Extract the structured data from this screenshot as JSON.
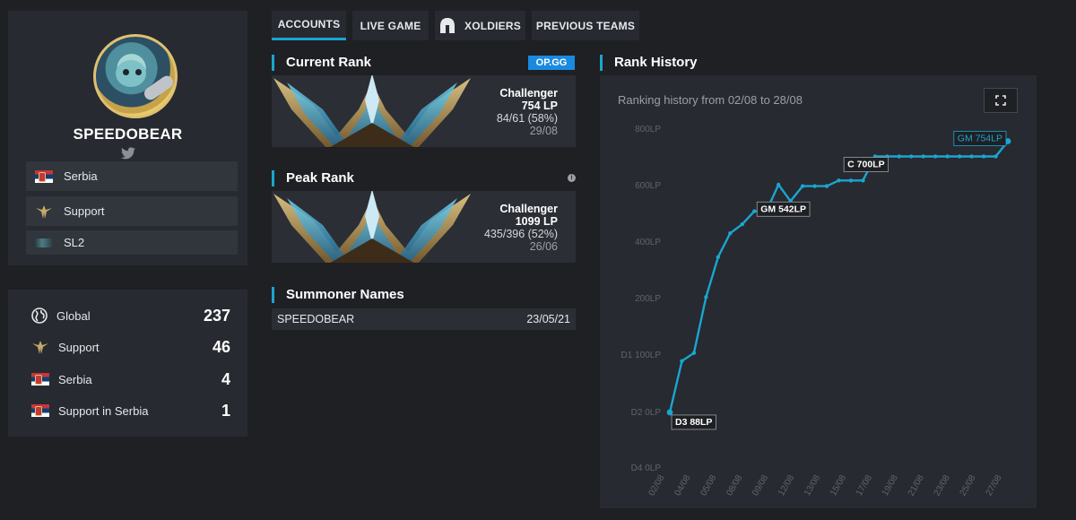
{
  "profile": {
    "name": "SPEEDOBEAR",
    "twitter_icon": "twitter-icon",
    "info": [
      {
        "icon": "serbia-flag-icon",
        "label": "Serbia"
      },
      {
        "icon": "support-role-icon",
        "label": "Support"
      },
      {
        "icon": "league-logo-icon",
        "label": "SL2"
      }
    ]
  },
  "stats": [
    {
      "icon": "globe-icon",
      "label": "Global",
      "value": "237"
    },
    {
      "icon": "support-role-icon",
      "label": "Support",
      "value": "46"
    },
    {
      "icon": "serbia-flag-icon",
      "label": "Serbia",
      "value": "4"
    },
    {
      "icon": "serbia-flag-icon",
      "label": "Support in Serbia",
      "value": "1"
    }
  ],
  "tabs": [
    {
      "label": "ACCOUNTS",
      "active": true
    },
    {
      "label": "LIVE GAME",
      "active": false
    },
    {
      "label": "XOLDIERS",
      "active": false,
      "icon": "helmet-icon"
    },
    {
      "label": "PREVIOUS TEAMS",
      "active": false
    }
  ],
  "current_rank": {
    "heading": "Current Rank",
    "badge": "OP.GG",
    "tier": "Challenger",
    "lp": "754 LP",
    "record": "84/61 (58%)",
    "date": "29/08"
  },
  "peak_rank": {
    "heading": "Peak Rank",
    "info_icon": "info-icon",
    "tier": "Challenger",
    "lp": "1099 LP",
    "record": "435/396 (52%)",
    "date": "26/06"
  },
  "summoner_names": {
    "heading": "Summoner Names",
    "rows": [
      {
        "name": "SPEEDOBEAR",
        "date": "23/05/21"
      }
    ]
  },
  "rank_history": {
    "heading": "Rank History",
    "subtitle": "Ranking history from 02/08 to 28/08",
    "fullscreen_icon": "fullscreen-icon"
  },
  "colors": {
    "accent": "#1ba5d0",
    "background": "#1e2024",
    "panel": "#272a30",
    "opgg": "#1a8ae0"
  },
  "chart_data": {
    "type": "line",
    "title": "",
    "xlabel": "",
    "ylabel": "",
    "y_tick_labels": [
      "D4 0LP",
      "D2 0LP",
      "D1 100LP",
      "200LP",
      "400LP",
      "600LP",
      "800LP"
    ],
    "y_tick_values": [
      -200,
      0,
      100,
      200,
      400,
      600,
      800
    ],
    "ylim": [
      -200,
      800
    ],
    "x_tick_labels": [
      "02/08",
      "04/08",
      "05/08",
      "08/08",
      "09/08",
      "12/08",
      "13/08",
      "15/08",
      "17/08",
      "19/08",
      "21/08",
      "23/08",
      "25/08",
      "27/08"
    ],
    "grid": false,
    "series": [
      {
        "values": [
          -3,
          88,
          102,
          202,
          344,
          428,
          460,
          506,
          506,
          600,
          542,
          595,
          595,
          595,
          615,
          615,
          615,
          700,
          700,
          700,
          700,
          700,
          700,
          700,
          700,
          700,
          700,
          700,
          754
        ]
      }
    ],
    "annotations": [
      {
        "index": 0,
        "text": "D3 88LP"
      },
      {
        "index": 10,
        "text": "GM 542LP"
      },
      {
        "index": 17,
        "text": "C 700LP"
      },
      {
        "index": 28,
        "text": "GM 754LP"
      }
    ]
  }
}
